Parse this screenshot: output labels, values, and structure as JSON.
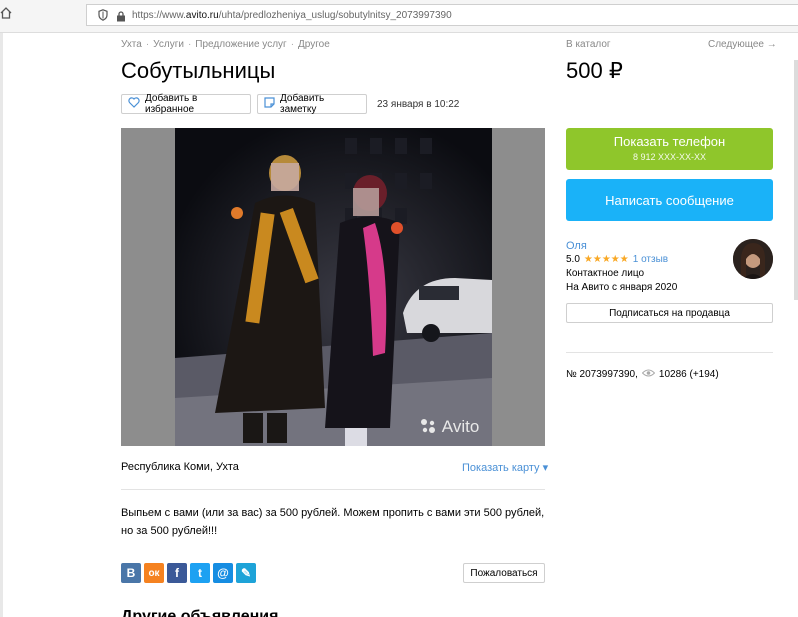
{
  "browser": {
    "url_prefix": "https://www.",
    "url_domain": "avito.ru",
    "url_path": "/uhta/predlozheniya_uslug/sobutylnitsy_2073997390"
  },
  "breadcrumbs": [
    "Ухта",
    "Услуги",
    "Предложение услуг",
    "Другое"
  ],
  "nav": {
    "catalog": "В каталог",
    "next": "Следующее →"
  },
  "listing": {
    "title": "Собутыльницы",
    "price": "500 ₽",
    "add_favorite": "Добавить в избранное",
    "add_note": "Добавить заметку",
    "date": "23 января в 10:22",
    "watermark": "Avito",
    "location": "Республика Коми, Ухта",
    "show_map": "Показать карту ▾",
    "description_line1": "Выпьем с вами (или за вас) за 500 рублей. Можем пропить с вами эти 500 рублей,",
    "description_line2": "но за 500 рублей!!!",
    "report": "Пожаловаться",
    "next_section_partial": "Другие объявления"
  },
  "share": [
    {
      "icon": "vk-icon",
      "glyph": "В",
      "color": "#4a76a8"
    },
    {
      "icon": "odnoklassniki-icon",
      "glyph": "ок",
      "color": "#f58220"
    },
    {
      "icon": "facebook-icon",
      "glyph": "f",
      "color": "#3b5998"
    },
    {
      "icon": "twitter-icon",
      "glyph": "t",
      "color": "#1da1f2"
    },
    {
      "icon": "mail-icon",
      "glyph": "@",
      "color": "#168de2"
    },
    {
      "icon": "livejournal-icon",
      "glyph": "✎",
      "color": "#1ea3d8"
    }
  ],
  "contact": {
    "show_phone": "Показать телефон",
    "phone_masked": "8 912 XXX-XX-XX",
    "write_message": "Написать сообщение",
    "seller_name": "Оля",
    "rating": "5.0",
    "stars": "★★★★★",
    "reviews": "1 отзыв",
    "contact_person": "Контактное лицо",
    "on_avito_since": "На Авито с января 2020",
    "subscribe": "Подписаться на продавца"
  },
  "stats": {
    "ad_number": "№ 2073997390,",
    "views": "10286 (+194)"
  },
  "colors": {
    "phone_button": "#8fc62b",
    "message_button": "#1ab2f8",
    "link": "#4a90d6"
  }
}
